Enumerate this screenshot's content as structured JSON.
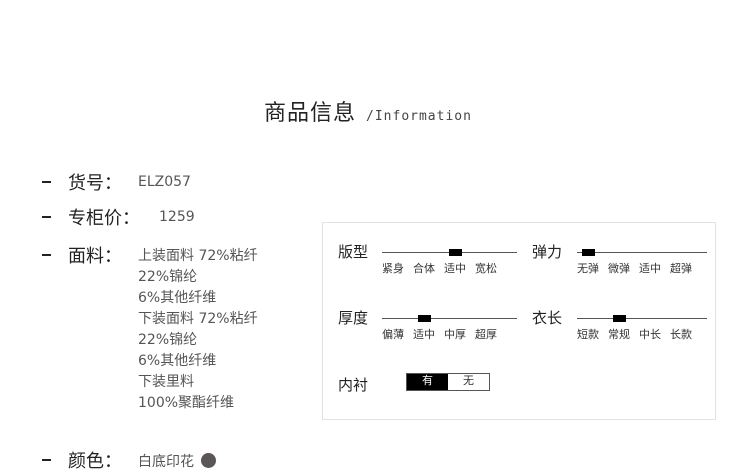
{
  "header": {
    "title": "商品信息",
    "subtitle": "/Information"
  },
  "info": {
    "item_no": {
      "label": "货号：",
      "value": "ELZ057"
    },
    "price": {
      "label": "专柜价：",
      "value": "1259"
    },
    "fabric": {
      "label": "面料：",
      "lines": [
        "上装面料 72%粘纤",
        "22%锦纶",
        "6%其他纤维",
        "下装面料 72%粘纤",
        "22%锦纶",
        "6%其他纤维",
        "下装里料",
        "100%聚酯纤维"
      ]
    },
    "color": {
      "label": "颜色：",
      "value": "白底印花",
      "swatch": "#5a5558"
    }
  },
  "attributes": {
    "fit": {
      "label": "版型",
      "options": [
        "紧身",
        "合体",
        "适中",
        "宽松"
      ],
      "selected": "适中"
    },
    "elasticity": {
      "label": "弹力",
      "options": [
        "无弹",
        "微弹",
        "适中",
        "超弹"
      ],
      "selected": "无弹"
    },
    "thickness": {
      "label": "厚度",
      "options": [
        "偏薄",
        "适中",
        "中厚",
        "超厚"
      ],
      "selected": "适中"
    },
    "length": {
      "label": "衣长",
      "options": [
        "短款",
        "常规",
        "中长",
        "长款"
      ],
      "selected": "常规"
    },
    "lining": {
      "label": "内衬",
      "options": [
        "有",
        "无"
      ],
      "selected": "有"
    }
  }
}
